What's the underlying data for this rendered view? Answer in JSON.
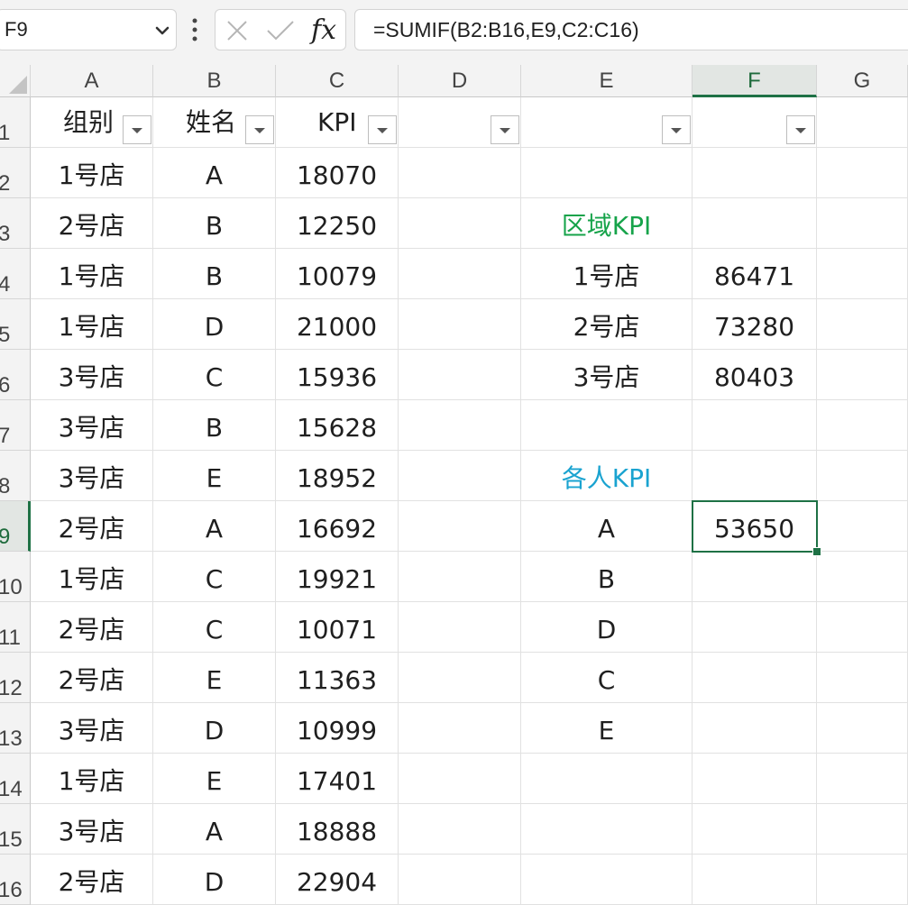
{
  "formula_bar": {
    "name_box": "F9",
    "formula": "=SUMIF(B2:B16,E9,C2:C16)",
    "icons": [
      "chevron-down-icon",
      "more-vertical-icon",
      "cancel-icon",
      "confirm-icon",
      "function-icon"
    ],
    "fx_label": "fx"
  },
  "sheet": {
    "columns": [
      "A",
      "B",
      "C",
      "D",
      "E",
      "F",
      "G"
    ],
    "selected_column": "F",
    "selected_row": "9",
    "rows": [
      {
        "num": "1",
        "cells": [
          "组别",
          "姓名",
          "KPI",
          "",
          "",
          "",
          ""
        ]
      },
      {
        "num": "2",
        "cells": [
          "1号店",
          "A",
          "18070",
          "",
          "",
          "",
          ""
        ]
      },
      {
        "num": "3",
        "cells": [
          "2号店",
          "B",
          "12250",
          "",
          "区域KPI",
          "",
          ""
        ]
      },
      {
        "num": "4",
        "cells": [
          "1号店",
          "B",
          "10079",
          "",
          "1号店",
          "86471",
          ""
        ]
      },
      {
        "num": "5",
        "cells": [
          "1号店",
          "D",
          "21000",
          "",
          "2号店",
          "73280",
          ""
        ]
      },
      {
        "num": "6",
        "cells": [
          "3号店",
          "C",
          "15936",
          "",
          "3号店",
          "80403",
          ""
        ]
      },
      {
        "num": "7",
        "cells": [
          "3号店",
          "B",
          "15628",
          "",
          "",
          "",
          ""
        ]
      },
      {
        "num": "8",
        "cells": [
          "3号店",
          "E",
          "18952",
          "",
          "各人KPI",
          "",
          ""
        ]
      },
      {
        "num": "9",
        "cells": [
          "2号店",
          "A",
          "16692",
          "",
          "A",
          "53650",
          ""
        ]
      },
      {
        "num": "10",
        "cells": [
          "1号店",
          "C",
          "19921",
          "",
          "B",
          "",
          ""
        ]
      },
      {
        "num": "11",
        "cells": [
          "2号店",
          "C",
          "10071",
          "",
          "D",
          "",
          ""
        ]
      },
      {
        "num": "12",
        "cells": [
          "2号店",
          "E",
          "11363",
          "",
          "C",
          "",
          ""
        ]
      },
      {
        "num": "13",
        "cells": [
          "3号店",
          "D",
          "10999",
          "",
          "E",
          "",
          ""
        ]
      },
      {
        "num": "14",
        "cells": [
          "1号店",
          "E",
          "17401",
          "",
          "",
          "",
          ""
        ]
      },
      {
        "num": "15",
        "cells": [
          "3号店",
          "A",
          "18888",
          "",
          "",
          "",
          ""
        ]
      },
      {
        "num": "16",
        "cells": [
          "2号店",
          "D",
          "22904",
          "",
          "",
          "",
          ""
        ]
      }
    ],
    "filter_icons": "filter-dropdown-icon",
    "colors": {
      "accent": "#1e7145",
      "region_title": "#16a34a",
      "person_title": "#1aa3d0"
    }
  }
}
